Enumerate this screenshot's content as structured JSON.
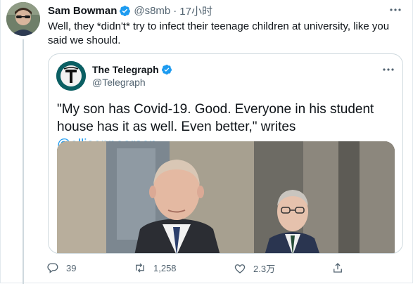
{
  "tweet": {
    "author_name": "Sam Bowman",
    "handle": "@s8mb",
    "separator": "·",
    "time": "17小时",
    "text": "Well, they *didn't* try to infect their teenage children at university, like you said we should."
  },
  "quoted": {
    "author_name": "The Telegraph",
    "handle": "@Telegraph",
    "text_main": "\"My son has Covid-19. Good. Everyone in his student house has it as well. Even better,\" writes ",
    "text_link": "@allisonpearson"
  },
  "actions": {
    "replies": "39",
    "retweets": "1,258",
    "likes": "2.3万"
  },
  "colors": {
    "verified": "#1d9bf0",
    "link": "#1d9bf0",
    "secondary_text": "#536471"
  },
  "icons": [
    "verified-badge-icon",
    "more-icon",
    "reply-icon",
    "retweet-icon",
    "like-icon",
    "share-icon"
  ]
}
